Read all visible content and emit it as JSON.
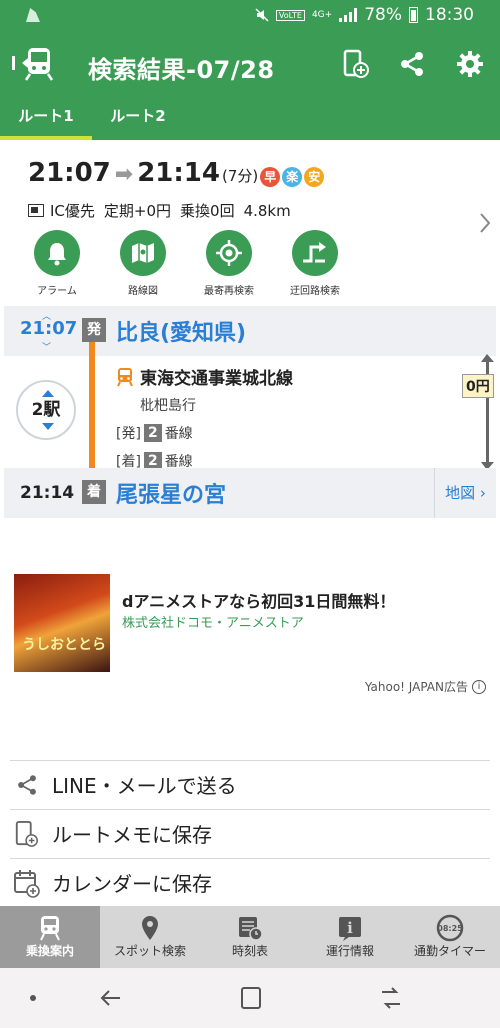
{
  "status": {
    "network": "4G+",
    "volte": "VoLTE",
    "battery": "78%",
    "time": "18:30"
  },
  "appbar": {
    "title": "検索結果-07/28",
    "icons": [
      "train-back-icon",
      "memo-add-icon",
      "share-icon",
      "gear-icon"
    ]
  },
  "tabs": [
    {
      "label": "ルート1",
      "active": true
    },
    {
      "label": "ルート2",
      "active": false
    }
  ],
  "summary": {
    "depart": "21:07",
    "arrive": "21:14",
    "duration": "(7分)",
    "badges": [
      {
        "label": "早",
        "color": "#e8553a"
      },
      {
        "label": "楽",
        "color": "#4cb3e6"
      },
      {
        "label": "安",
        "color": "#f2a81d"
      }
    ],
    "ic": "IC優先",
    "commuter": "定期+0円",
    "transfers": "乗換0回",
    "distance": "4.8km"
  },
  "actions": [
    {
      "label": "アラーム",
      "icon": "bell-icon"
    },
    {
      "label": "路線図",
      "icon": "route-map-icon"
    },
    {
      "label": "最寄再検索",
      "icon": "locate-icon"
    },
    {
      "label": "迂回路検索",
      "icon": "detour-icon"
    }
  ],
  "route": {
    "dep_time": "21:07",
    "dep_tag": "発",
    "dep_station": "比良(愛知県)",
    "stops": "2駅",
    "line": "東海交通事業城北線",
    "bound": "枇杷島行",
    "dep_plat_label": "[発]",
    "dep_plat": "2",
    "dep_plat_suffix": "番線",
    "arr_plat_label": "[着]",
    "arr_plat": "2",
    "arr_plat_suffix": "番線",
    "fare": "0円",
    "arr_time": "21:14",
    "arr_tag": "着",
    "arr_station": "尾張星の宮",
    "map_link": "地図"
  },
  "ad": {
    "title": "dアニメストアなら初回31日間無料！",
    "sponsor": "株式会社ドコモ・アニメストア",
    "label": "Yahoo! JAPAN広告",
    "image_logo": "うしおととら"
  },
  "share": [
    {
      "label": "LINE・メールで送る",
      "icon": "share-icon"
    },
    {
      "label": "ルートメモに保存",
      "icon": "memo-add-icon"
    },
    {
      "label": "カレンダーに保存",
      "icon": "calendar-add-icon"
    }
  ],
  "bottom_nav": [
    {
      "label": "乗換案内",
      "icon": "train-icon",
      "active": true
    },
    {
      "label": "スポット検索",
      "icon": "pin-icon",
      "active": false
    },
    {
      "label": "時刻表",
      "icon": "timetable-icon",
      "active": false
    },
    {
      "label": "運行情報",
      "icon": "info-icon",
      "active": false
    },
    {
      "label": "通勤タイマー",
      "icon": "timer-icon",
      "active": false,
      "badge": "08:25"
    }
  ],
  "colors": {
    "brand": "#3a9c55",
    "link": "#2a7fd4",
    "line": "#f08a1e"
  }
}
